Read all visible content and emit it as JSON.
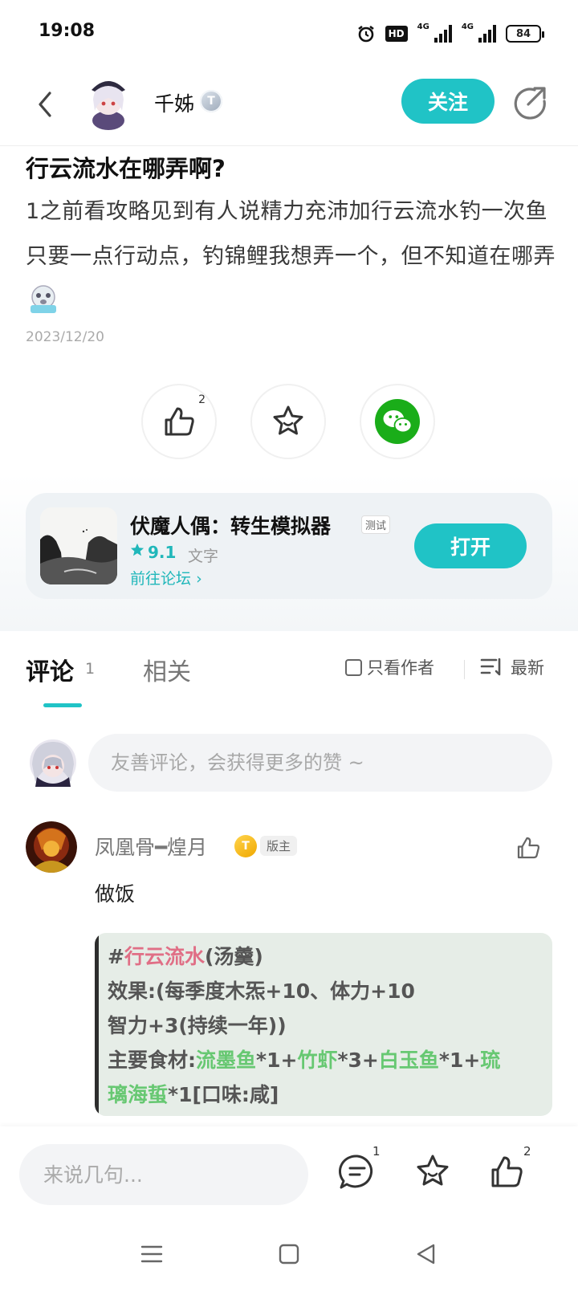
{
  "status_bar": {
    "time": "19:08",
    "hd_label": "HD",
    "network_1": "4G",
    "network_2": "4G",
    "battery": "84",
    "icons": [
      "alarm-icon",
      "hd-icon",
      "signal-icon",
      "signal-icon",
      "battery-icon"
    ]
  },
  "header": {
    "author_name": "千姊",
    "author_level": "T",
    "follow_label": "关注",
    "icons": [
      "back-arrow-icon",
      "share-icon"
    ]
  },
  "post": {
    "title": "行云流水在哪弄啊?",
    "body": "1之前看攻略见到有人说精力充沛加行云流水钓一次鱼只要一点行动点，钓锦鲤我想弄一个，但不知道在哪弄",
    "emoji_icon": "crying-face-emoji",
    "date": "2023/12/20"
  },
  "actions": {
    "like_count": "2",
    "icons": [
      "thumbs-up-icon",
      "star-icon",
      "wechat-icon"
    ],
    "colors": {
      "wechat": "#1aad19",
      "accent": "#20c3c6"
    }
  },
  "app_card": {
    "name": "伏魔人偶：转生模拟器",
    "tag": "测试",
    "rating": "9.1",
    "genre": "文字",
    "forum_link": "前往论坛",
    "open_label": "打开"
  },
  "tabs": {
    "comments_label": "评论",
    "comments_count": "1",
    "related_label": "相关",
    "author_only_label": "只看作者",
    "sort_label": "最新"
  },
  "comment_input": {
    "placeholder": "友善评论，会获得更多的赞 ~"
  },
  "comment": {
    "user_name": "凤凰骨━煌月",
    "level": "T",
    "role": "版主",
    "text": "做饭",
    "quote": {
      "line1_hash": "#",
      "line1_name": "行云流水",
      "line1_rest": "(汤羹)",
      "line2": "效果:(每季度木炁+10、体力+10",
      "line3": "智力+3(持续一年))",
      "line4_prefix": "主要食材:",
      "ing1": "流墨鱼",
      "ing1_qty": "*1+",
      "ing2": "竹虾",
      "ing2_qty": "*3+",
      "ing3": "白玉鱼",
      "ing3_qty": "*1+",
      "ing4_part1": "琉",
      "ing4_part2": "璃海蜇",
      "line5_rest": "*1[口味:咸]"
    }
  },
  "bottom_bar": {
    "placeholder": "来说几句...",
    "comment_count": "1",
    "like_count": "2",
    "icons": [
      "comment-icon",
      "star-icon",
      "thumbs-up-icon"
    ]
  },
  "nav_bar": {
    "icons": [
      "menu-icon",
      "home-square-icon",
      "back-triangle-icon"
    ]
  }
}
